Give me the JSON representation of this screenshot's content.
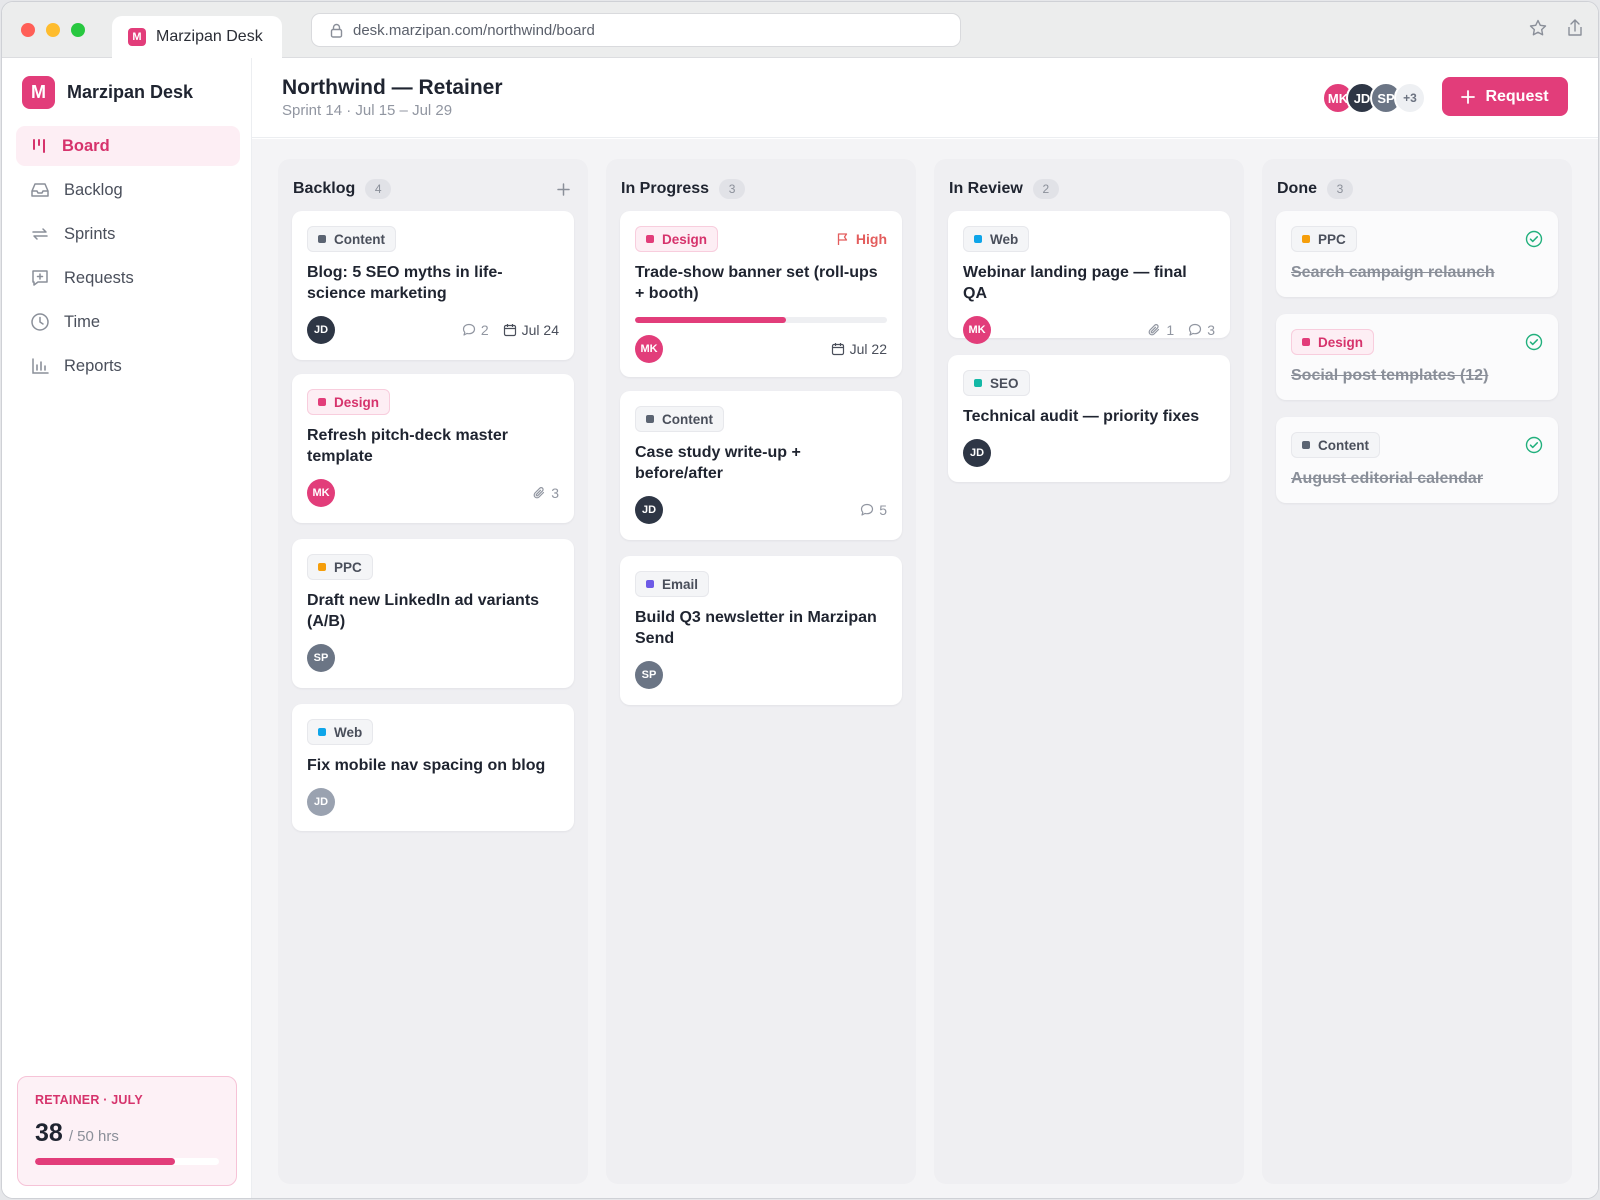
{
  "browser": {
    "tab_title": "Marzipan Desk",
    "tab_favicon": "M",
    "url": "desk.marzipan.com/northwind/board"
  },
  "sidebar": {
    "logo": "M",
    "brand": "Marzipan Desk",
    "items": [
      {
        "label": "Board",
        "icon": "board-icon",
        "active": true
      },
      {
        "label": "Backlog",
        "icon": "inbox-icon"
      },
      {
        "label": "Sprints",
        "icon": "repeat-icon"
      },
      {
        "label": "Requests",
        "icon": "request-icon"
      },
      {
        "label": "Time",
        "icon": "clock-icon"
      },
      {
        "label": "Reports",
        "icon": "bar-chart-icon"
      }
    ],
    "retainer": {
      "label": "RETAINER · JULY",
      "used": "38",
      "total": "/ 50 hrs",
      "fraction": 0.76
    }
  },
  "header": {
    "title": "Northwind — Retainer",
    "subtitle": "Sprint 14 · Jul 15 – Jul 29",
    "avatars": [
      "MK",
      "JD",
      "SP"
    ],
    "avatars_more": "+3",
    "request_label": "Request"
  },
  "columns": [
    {
      "title": "Backlog",
      "count": "4",
      "cards": [
        {
          "tag": "Content",
          "title": "Blog: 5 SEO myths in life-science marketing",
          "avatar": "JD",
          "comments": "2",
          "date": "Jul 24"
        },
        {
          "tag": "Design",
          "title": "Refresh pitch-deck master template",
          "avatar": "MK",
          "attachments": "3"
        },
        {
          "tag": "PPC",
          "title": "Draft new LinkedIn ad variants (A/B)",
          "avatar": "SP"
        },
        {
          "tag": "Web",
          "title": "Fix mobile nav spacing on blog",
          "avatar": "JD"
        }
      ]
    },
    {
      "title": "In Progress",
      "count": "3",
      "cards": [
        {
          "tag": "Design",
          "priority": "High",
          "title": "Trade-show banner set (roll-ups + booth)",
          "progress": 0.6,
          "avatar": "MK",
          "date": "Jul 22"
        },
        {
          "tag": "Content",
          "title": "Case study write-up + before/after",
          "avatar": "JD",
          "comments": "5"
        },
        {
          "tag": "Email",
          "title": "Build Q3 newsletter in Marzipan Send",
          "avatar": "SP"
        }
      ]
    },
    {
      "title": "In Review",
      "count": "2",
      "cards": [
        {
          "tag": "Web",
          "title": "Webinar landing page — final QA",
          "avatar": "MK",
          "attachments": "1",
          "comments": "3"
        },
        {
          "tag": "SEO",
          "title": "Technical audit — priority fixes",
          "avatar": "JD"
        }
      ]
    },
    {
      "title": "Done",
      "count": "3",
      "cards": [
        {
          "tag": "PPC",
          "title": "Search campaign relaunch"
        },
        {
          "tag": "Design",
          "title": "Social post templates (12)"
        },
        {
          "tag": "Content",
          "title": "August editorial calendar"
        }
      ]
    }
  ],
  "colors": {
    "accent": "#e23d7a",
    "content": "#5b6472",
    "design": "#e23d7a",
    "ppc": "#f59e0b",
    "web": "#0ea5e9",
    "seo": "#14b8a6",
    "email": "#6d5ae6",
    "done_check": "#22b07d",
    "priority_high": "#e35d5d"
  }
}
